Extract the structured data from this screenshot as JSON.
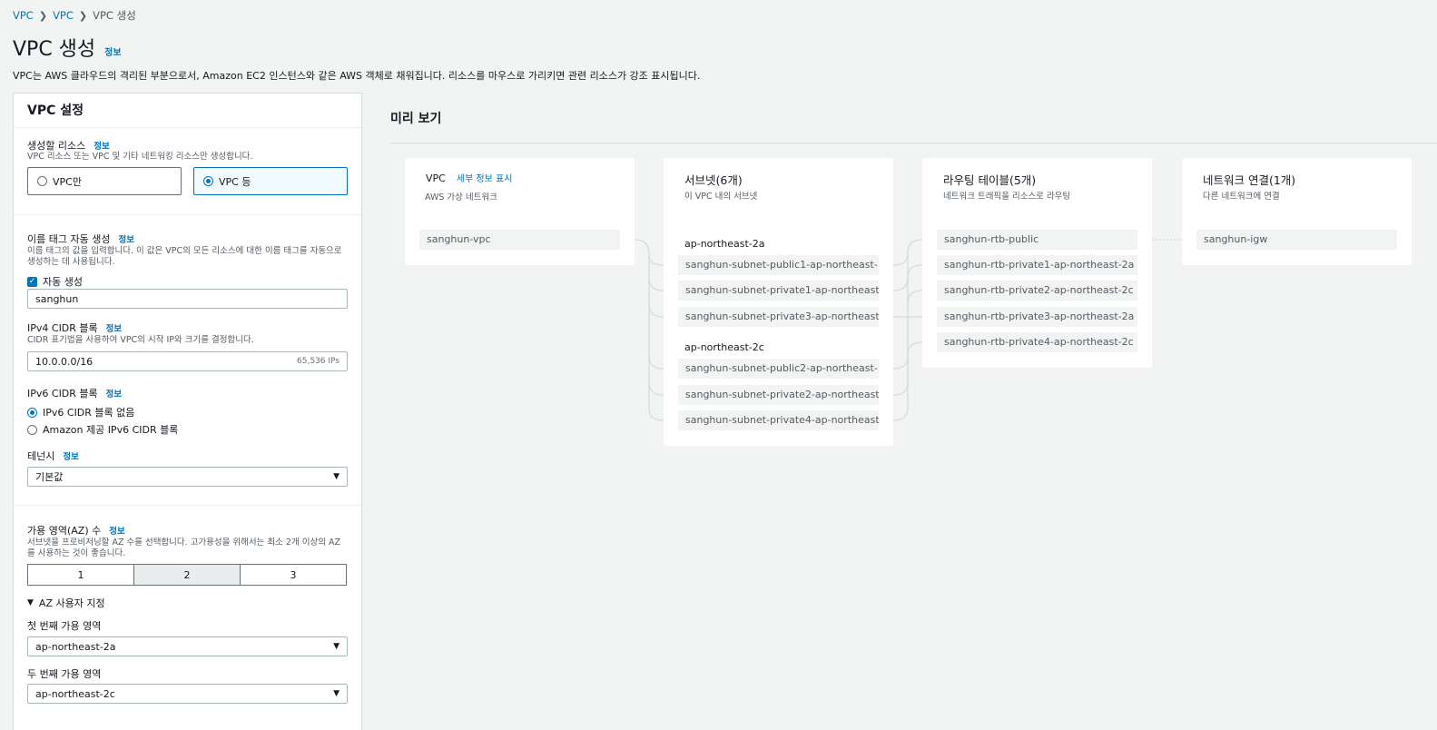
{
  "breadcrumb": {
    "items": [
      "VPC",
      "VPC"
    ],
    "current": "VPC 생성"
  },
  "page": {
    "title": "VPC 생성",
    "info": "정보",
    "description": "VPC는 AWS 클라우드의 격리된 부분으로서, Amazon EC2 인스턴스와 같은 AWS 객체로 채워집니다. 리소스를 마우스로 가리키면 관련 리소스가 강조 표시됩니다."
  },
  "settings": {
    "header": "VPC 설정",
    "resources": {
      "label": "생성할 리소스",
      "info": "정보",
      "desc": "VPC 리소스 또는 VPC 및 기타 네트워킹 리소스만 생성합니다.",
      "options": [
        "VPC만",
        "VPC 등"
      ],
      "selected": "VPC 등"
    },
    "name_tag": {
      "label": "이름 태그 자동 생성",
      "info": "정보",
      "desc": "이름 태그의 값을 입력합니다. 이 값은 VPC의 모든 리소스에 대한 이름 태그를 자동으로 생성하는 데 사용됩니다.",
      "checkbox_label": "자동 생성",
      "checked": true,
      "value": "sanghun"
    },
    "ipv4": {
      "label": "IPv4 CIDR 블록",
      "info": "정보",
      "desc": "CIDR 표기법을 사용하여 VPC의 시작 IP와 크기를 결정합니다.",
      "value": "10.0.0.0/16",
      "hint": "65,536 IPs"
    },
    "ipv6": {
      "label": "IPv6 CIDR 블록",
      "info": "정보",
      "options": [
        "IPv6 CIDR 블록 없음",
        "Amazon 제공 IPv6 CIDR 블록"
      ],
      "selected": "IPv6 CIDR 블록 없음"
    },
    "tenancy": {
      "label": "테넌시",
      "info": "정보",
      "value": "기본값"
    },
    "az_count": {
      "label": "가용 영역(AZ) 수",
      "info": "정보",
      "desc": "서브넷을 프로비저닝할 AZ 수를 선택합니다. 고가용성을 위해서는 최소 2개 이상의 AZ를 사용하는 것이 좋습니다.",
      "options": [
        "1",
        "2",
        "3"
      ],
      "selected": "2"
    },
    "customize_az": {
      "label": "AZ 사용자 지정",
      "expanded": true
    },
    "first_az": {
      "label": "첫 번째 가용 영역",
      "value": "ap-northeast-2a"
    },
    "second_az": {
      "label": "두 번째 가용 영역",
      "value": "ap-northeast-2c"
    }
  },
  "preview": {
    "title": "미리 보기",
    "vpc": {
      "title": "VPC",
      "details_link": "세부 정보 표시",
      "sub": "AWS 가상 네트워크",
      "name": "sanghun-vpc"
    },
    "subnets": {
      "title": "서브넷(6개)",
      "sub": "이 VPC 내의 서브넷",
      "groups": [
        {
          "az": "ap-northeast-2a",
          "items": [
            "sanghun-subnet-public1-ap-northeast-",
            "sanghun-subnet-private1-ap-northeast-",
            "sanghun-subnet-private3-ap-northeast-"
          ]
        },
        {
          "az": "ap-northeast-2c",
          "items": [
            "sanghun-subnet-public2-ap-northeast-",
            "sanghun-subnet-private2-ap-northeast-",
            "sanghun-subnet-private4-ap-northeast-"
          ]
        }
      ]
    },
    "route_tables": {
      "title": "라우팅 테이블(5개)",
      "sub": "네트워크 트래픽을 리소스로 라우팅",
      "items": [
        "sanghun-rtb-public",
        "sanghun-rtb-private1-ap-northeast-2a",
        "sanghun-rtb-private2-ap-northeast-2c",
        "sanghun-rtb-private3-ap-northeast-2a",
        "sanghun-rtb-private4-ap-northeast-2c"
      ]
    },
    "network": {
      "title": "네트워크 연결(1개)",
      "sub": "다른 네트워크에 연결",
      "items": [
        "sanghun-igw"
      ]
    }
  },
  "colors": {
    "link": "#0073bb",
    "background": "#f2f3f3",
    "connector": "#d5dbdb"
  }
}
